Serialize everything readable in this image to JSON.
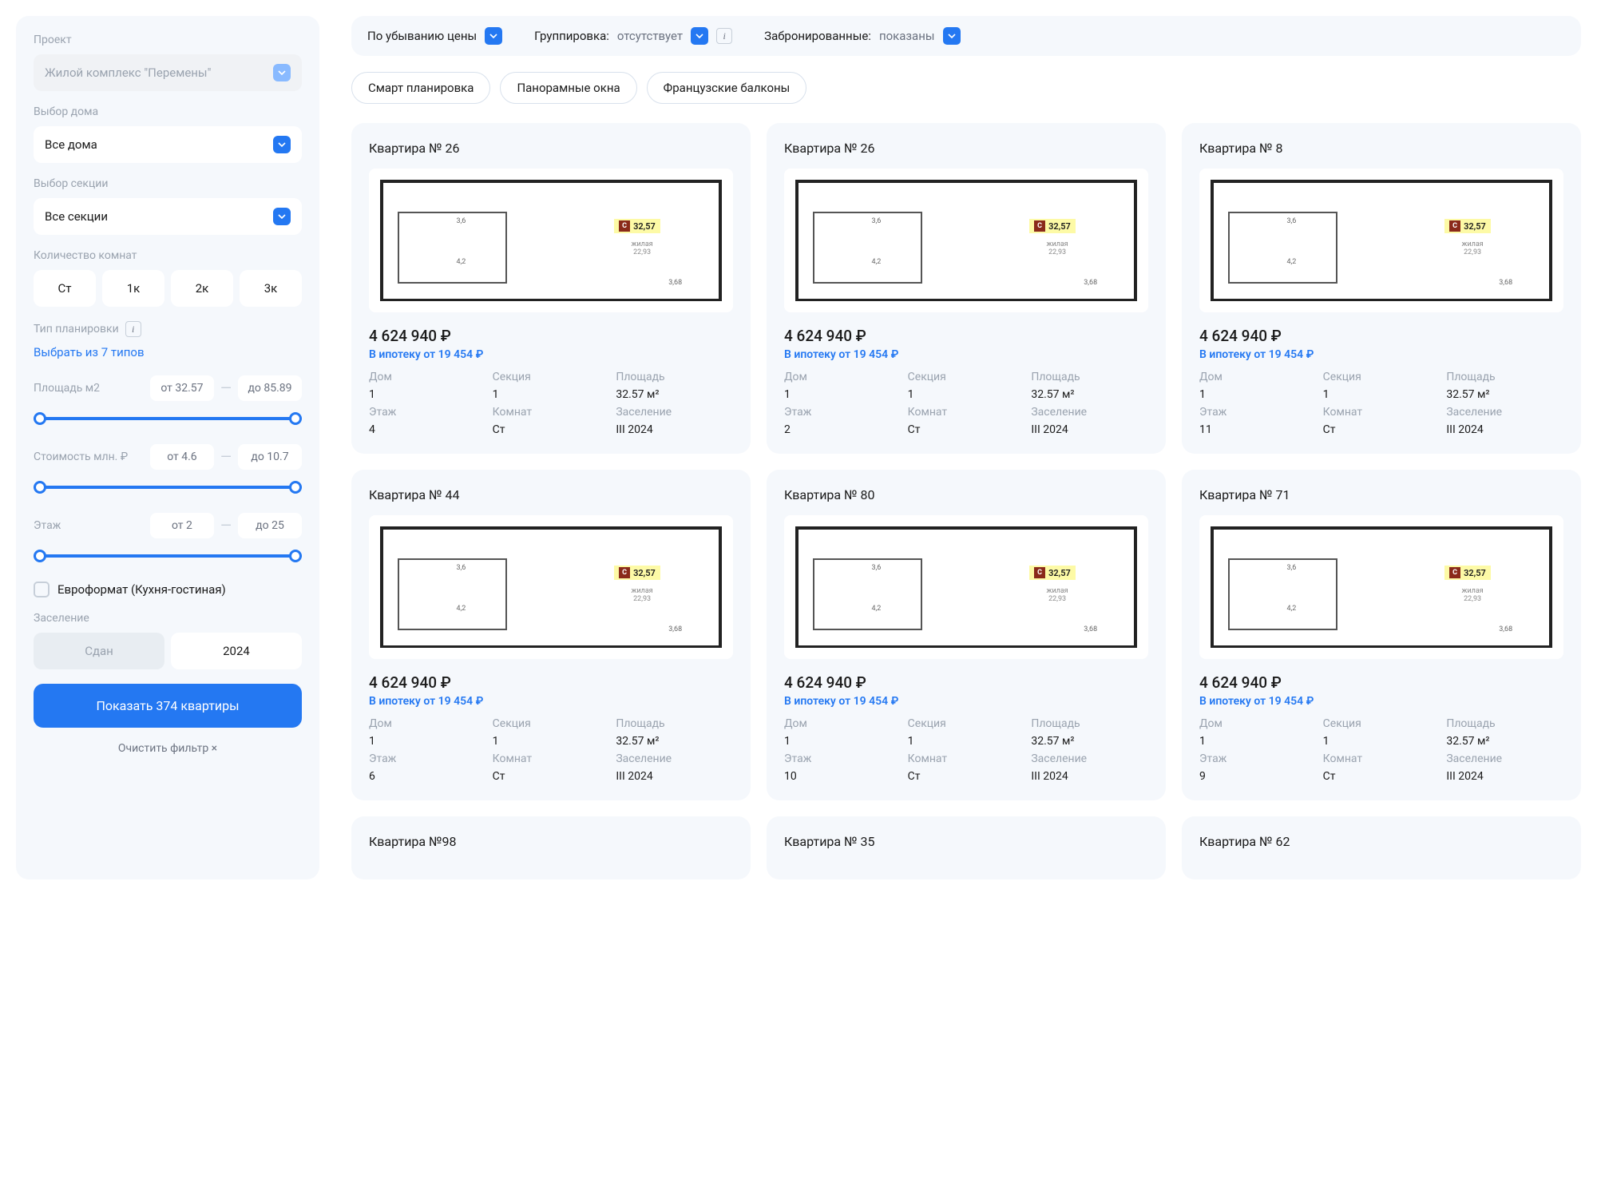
{
  "sidebar": {
    "project_label": "Проект",
    "project_value": "Жилой комплекс \"Перемены\"",
    "house_label": "Выбор дома",
    "house_value": "Все дома",
    "section_label": "Выбор секции",
    "section_value": "Все секции",
    "rooms_label": "Количество комнат",
    "rooms": [
      "Ст",
      "1к",
      "2к",
      "3к"
    ],
    "plan_type_label": "Тип планировки",
    "plan_type_link": "Выбрать из 7 типов",
    "area": {
      "label": "Площадь м2",
      "from": "от 32.57",
      "to": "до 85.89"
    },
    "price": {
      "label": "Стоимость млн. ₽",
      "from": "от 4.6",
      "to": "до 10.7"
    },
    "floor": {
      "label": "Этаж",
      "from": "от 2",
      "to": "до 25"
    },
    "euro_checkbox": "Евроформат (Кухня-гостиная)",
    "occupancy_label": "Заселение",
    "occupancy_options": [
      "Сдан",
      "2024"
    ],
    "show_button": "Показать 374 квартиры",
    "clear": "Очистить фильтр  ×"
  },
  "toolbar": {
    "sort": "По убыванию цены",
    "group_label": "Группировка:",
    "group_value": "отсутствует",
    "booked_label": "Забронированные:",
    "booked_value": "показаны"
  },
  "chips": [
    "Смарт планировка",
    "Панорамные окна",
    "Французские балконы"
  ],
  "plan": {
    "area": "32,57",
    "living_label": "жилая",
    "living_value": "22,93",
    "dim1": "3,6",
    "dim2": "4,2",
    "dim3": "3,68"
  },
  "cards": [
    {
      "title": "Квартира № 26",
      "price": "4 624 940 ₽",
      "mortgage": "В ипотеку от 19 454 ₽",
      "house": "1",
      "section": "1",
      "area": "32.57 м²",
      "floor": "4",
      "rooms": "Ст",
      "move": "III 2024"
    },
    {
      "title": "Квартира № 26",
      "price": "4 624 940 ₽",
      "mortgage": "В ипотеку от 19 454 ₽",
      "house": "1",
      "section": "1",
      "area": "32.57 м²",
      "floor": "2",
      "rooms": "Ст",
      "move": "III 2024"
    },
    {
      "title": "Квартира № 8",
      "price": "4 624 940 ₽",
      "mortgage": "В ипотеку от 19 454 ₽",
      "house": "1",
      "section": "1",
      "area": "32.57 м²",
      "floor": "11",
      "rooms": "Ст",
      "move": "III 2024"
    },
    {
      "title": "Квартира № 44",
      "price": "4 624 940 ₽",
      "mortgage": "В ипотеку от 19 454 ₽",
      "house": "1",
      "section": "1",
      "area": "32.57 м²",
      "floor": "6",
      "rooms": "Ст",
      "move": "III 2024"
    },
    {
      "title": "Квартира № 80",
      "price": "4 624 940 ₽",
      "mortgage": "В ипотеку от 19 454 ₽",
      "house": "1",
      "section": "1",
      "area": "32.57 м²",
      "floor": "10",
      "rooms": "Ст",
      "move": "III 2024"
    },
    {
      "title": "Квартира № 71",
      "price": "4 624 940 ₽",
      "mortgage": "В ипотеку от 19 454 ₽",
      "house": "1",
      "section": "1",
      "area": "32.57 м²",
      "floor": "9",
      "rooms": "Ст",
      "move": "III 2024"
    },
    {
      "title": "Квартира №98"
    },
    {
      "title": "Квартира № 35"
    },
    {
      "title": "Квартира № 62"
    }
  ],
  "detail_labels": {
    "house": "Дом",
    "section": "Секция",
    "area": "Площадь",
    "floor": "Этаж",
    "rooms": "Комнат",
    "move": "Заселение"
  }
}
